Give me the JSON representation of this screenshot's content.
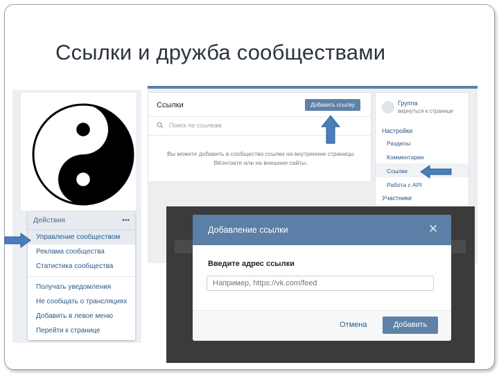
{
  "slide": {
    "title": "Ссылки и дружба сообществами"
  },
  "community_menu": {
    "header_label": "Действия",
    "header_more": "•••",
    "items": [
      "Управление сообществом",
      "Реклама сообщества",
      "Статистика сообщества",
      "Получать уведомления",
      "Не сообщать о трансляциях",
      "Добавить в левое меню",
      "Перейти к странице"
    ]
  },
  "links_panel": {
    "title": "Ссылки",
    "add_button": "Добавить ссылку",
    "search_placeholder": "Поиск по ссылкам",
    "empty_line1": "Вы можете добавить в сообщество ссылки на внутренние страницы",
    "empty_line2": "ВКонтакте или на внешние сайты."
  },
  "settings_menu": {
    "group_name": "Группа",
    "back_link": "вернуться к странице",
    "section": "Настройки",
    "items": [
      "Разделы",
      "Комментарии",
      "Ссылки",
      "Работа с API"
    ],
    "members": "Участники"
  },
  "modal": {
    "title": "Добавление ссылки",
    "close": "✕",
    "label": "Введите адрес ссылки",
    "input_placeholder": "Например, https://vk.com/feed",
    "cancel": "Отмена",
    "submit": "Добавить"
  },
  "colors": {
    "vk_blue": "#5b7fa6",
    "link_text": "#2a5885",
    "arrow_fill": "#4a7ebb"
  }
}
